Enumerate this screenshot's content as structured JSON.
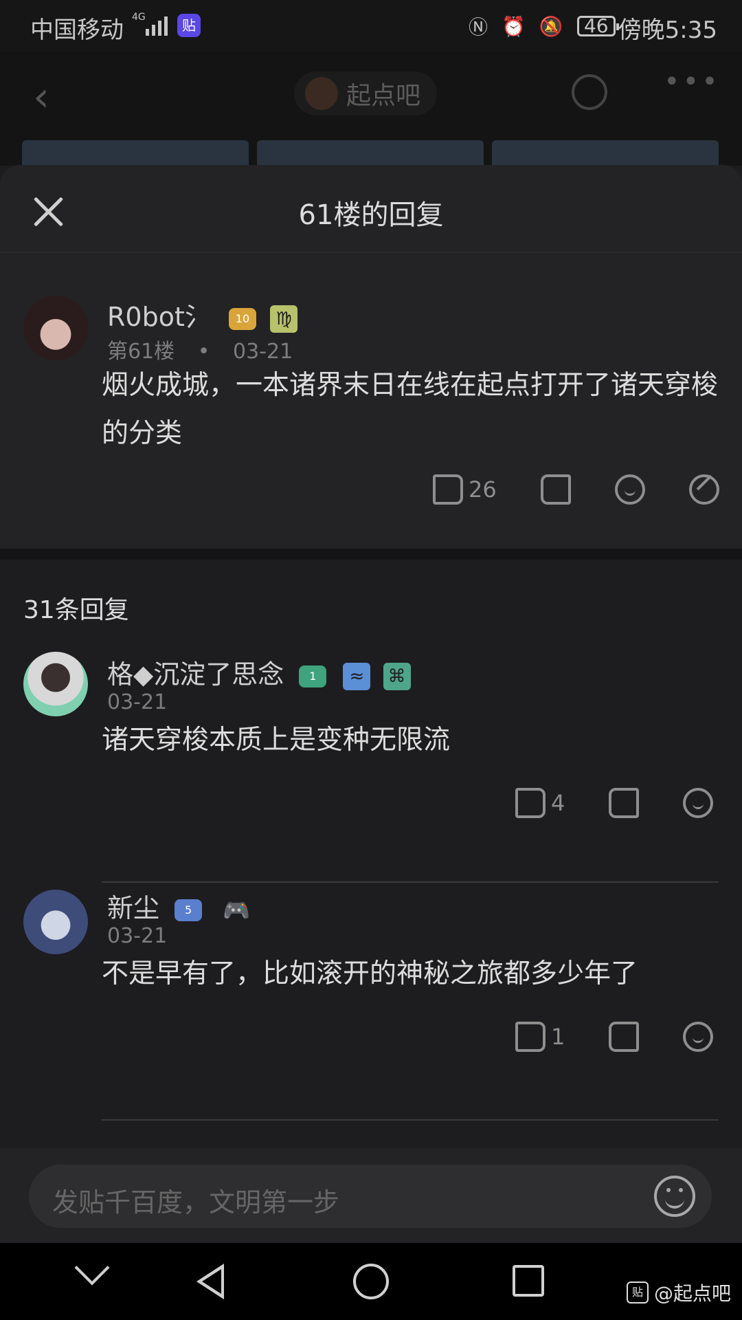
{
  "status": {
    "carrier": "中国移动",
    "net": "4G",
    "app_badge": "贴",
    "battery": "46",
    "time": "傍晚5:35"
  },
  "background_header": {
    "forum_name": "起点吧"
  },
  "sheet": {
    "title": "61楼的回复"
  },
  "main_post": {
    "username": "R0bot氵",
    "level": "10",
    "zodiac_icon": "♍",
    "floor": "第61楼",
    "dot": "•",
    "date": "03-21",
    "content": "烟火成城，一本诸界末日在线在起点打开了诸天穿梭的分类",
    "likes": "26"
  },
  "replies_count": "31条回复",
  "replies": [
    {
      "username": "格◆沉淀了思念",
      "level": "1",
      "date": "03-21",
      "content": "诸天穿梭本质上是变种无限流",
      "likes": "4"
    },
    {
      "username": "新尘",
      "level": "5",
      "date": "03-21",
      "content": "不是早有了，比如滚开的神秘之旅都多少年了",
      "likes": "1"
    }
  ],
  "input": {
    "placeholder": "发贴千百度，文明第一步"
  },
  "watermark": {
    "icon": "贴",
    "text": "@起点吧"
  },
  "colors": {
    "background": "#1d1d1f",
    "sheet_header": "#232325",
    "text": "#dcdcdc",
    "muted": "#7d7d7d",
    "level_gold": "#d9a53a",
    "level_green": "#3fa37e",
    "level_blue": "#5b7fcf"
  }
}
